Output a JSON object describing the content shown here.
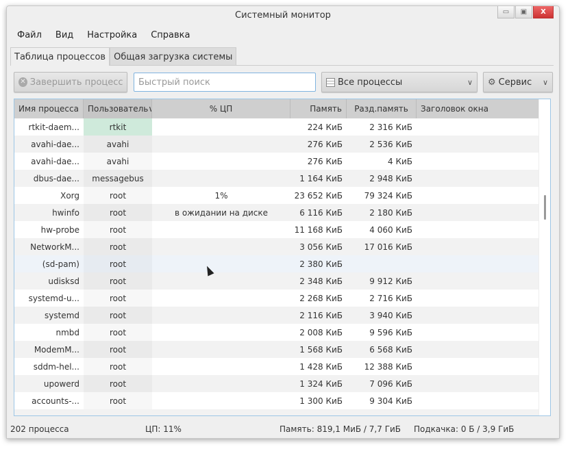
{
  "window": {
    "title": "Системный монитор",
    "minimize": "▭",
    "maximize": "▣",
    "close": "X"
  },
  "menu": [
    "Файл",
    "Вид",
    "Настройка",
    "Справка"
  ],
  "tabs": [
    "Таблица процессов",
    "Общая загрузка системы"
  ],
  "toolbar": {
    "kill_label": "Завершить процесс...",
    "search_placeholder": "Быстрый поиск",
    "filter_label": "Все процессы",
    "tools_label": "Сервис"
  },
  "columns": [
    "Имя процесса",
    "Пользователь",
    "% ЦП",
    "Память",
    "Разд.память",
    "Заголовок окна"
  ],
  "rows": [
    [
      "rtkit-daem...",
      "rtkit",
      "",
      "224 КиБ",
      "2 316 КиБ",
      ""
    ],
    [
      "avahi-dae...",
      "avahi",
      "",
      "276 КиБ",
      "2 536 КиБ",
      ""
    ],
    [
      "avahi-dae...",
      "avahi",
      "",
      "276 КиБ",
      "4 КиБ",
      ""
    ],
    [
      "dbus-dae...",
      "messagebus",
      "",
      "1 164 КиБ",
      "2 948 КиБ",
      ""
    ],
    [
      "Xorg",
      "root",
      "1%",
      "23 652 КиБ",
      "79 324 КиБ",
      ""
    ],
    [
      "hwinfo",
      "root",
      "в ожидании на диске",
      "6 116 КиБ",
      "2 180 КиБ",
      ""
    ],
    [
      "hw-probe",
      "root",
      "",
      "11 168 КиБ",
      "4 060 КиБ",
      ""
    ],
    [
      "NetworkM...",
      "root",
      "",
      "3 056 КиБ",
      "17 016 КиБ",
      ""
    ],
    [
      "(sd-pam)",
      "root",
      "",
      "2 380 КиБ",
      "",
      ""
    ],
    [
      "udisksd",
      "root",
      "",
      "2 348 КиБ",
      "9 912 КиБ",
      ""
    ],
    [
      "systemd-u...",
      "root",
      "",
      "2 268 КиБ",
      "2 716 КиБ",
      ""
    ],
    [
      "systemd",
      "root",
      "",
      "2 116 КиБ",
      "3 940 КиБ",
      ""
    ],
    [
      "nmbd",
      "root",
      "",
      "2 008 КиБ",
      "9 596 КиБ",
      ""
    ],
    [
      "ModemM...",
      "root",
      "",
      "1 568 КиБ",
      "6 568 КиБ",
      ""
    ],
    [
      "sddm-hel...",
      "root",
      "",
      "1 428 КиБ",
      "12 388 КиБ",
      ""
    ],
    [
      "upowerd",
      "root",
      "",
      "1 324 КиБ",
      "7 096 КиБ",
      ""
    ],
    [
      "accounts-...",
      "root",
      "",
      "1 300 КиБ",
      "9 304 КиБ",
      ""
    ]
  ],
  "status": {
    "processes": "202 процесса",
    "cpu": "ЦП: 11%",
    "memory": "Память: 819,1 МиБ / 7,7 ГиБ",
    "swap": "Подкачка: 0 Б / 3,9 ГиБ"
  },
  "colors": {
    "highlight": "#cfeadb",
    "accent": "#7fb3df"
  }
}
